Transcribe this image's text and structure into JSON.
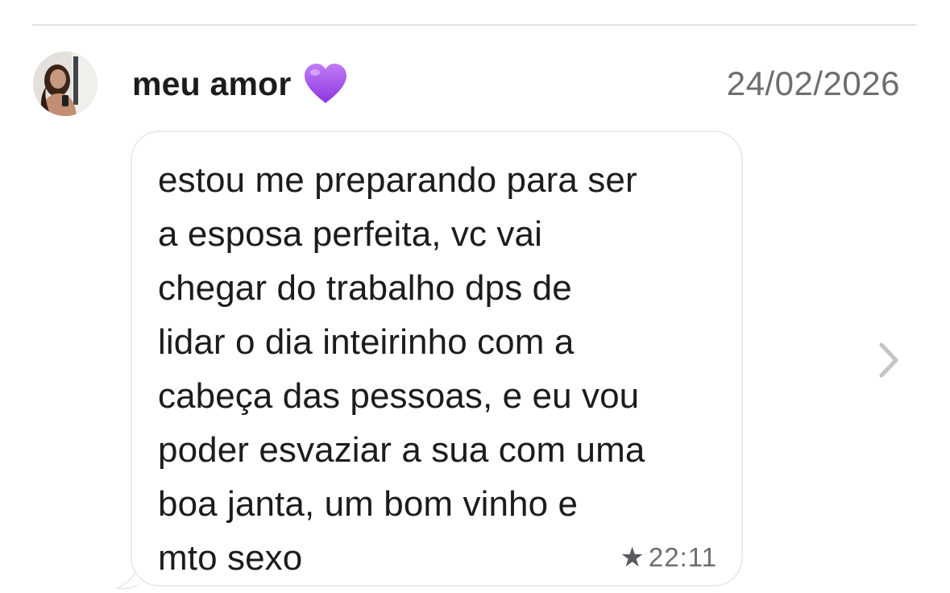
{
  "thread": {
    "sender_name": "meu amor",
    "sender_emoji": "purple-heart",
    "date": "24/02/2026"
  },
  "message": {
    "text": "estou me preparando para ser\na esposa perfeita, vc vai\nchegar do trabalho dps de\nlidar o dia inteirinho com a\ncabeça das pessoas, e eu vou\npoder esvaziar a sua com uma\nboa janta, um bom vinho e\nmto sexo",
    "starred_icon": "★",
    "time": "22:11"
  },
  "icons": {
    "avatar": "profile-photo",
    "heart": "purple-heart-icon",
    "star": "star-icon",
    "chevron": "chevron-right-icon"
  },
  "colors": {
    "heart": "#a24ee8",
    "text": "#1c1c1e",
    "secondary": "#6d6d72",
    "bubble_border": "#ececee",
    "chevron": "#c4c4c7"
  }
}
